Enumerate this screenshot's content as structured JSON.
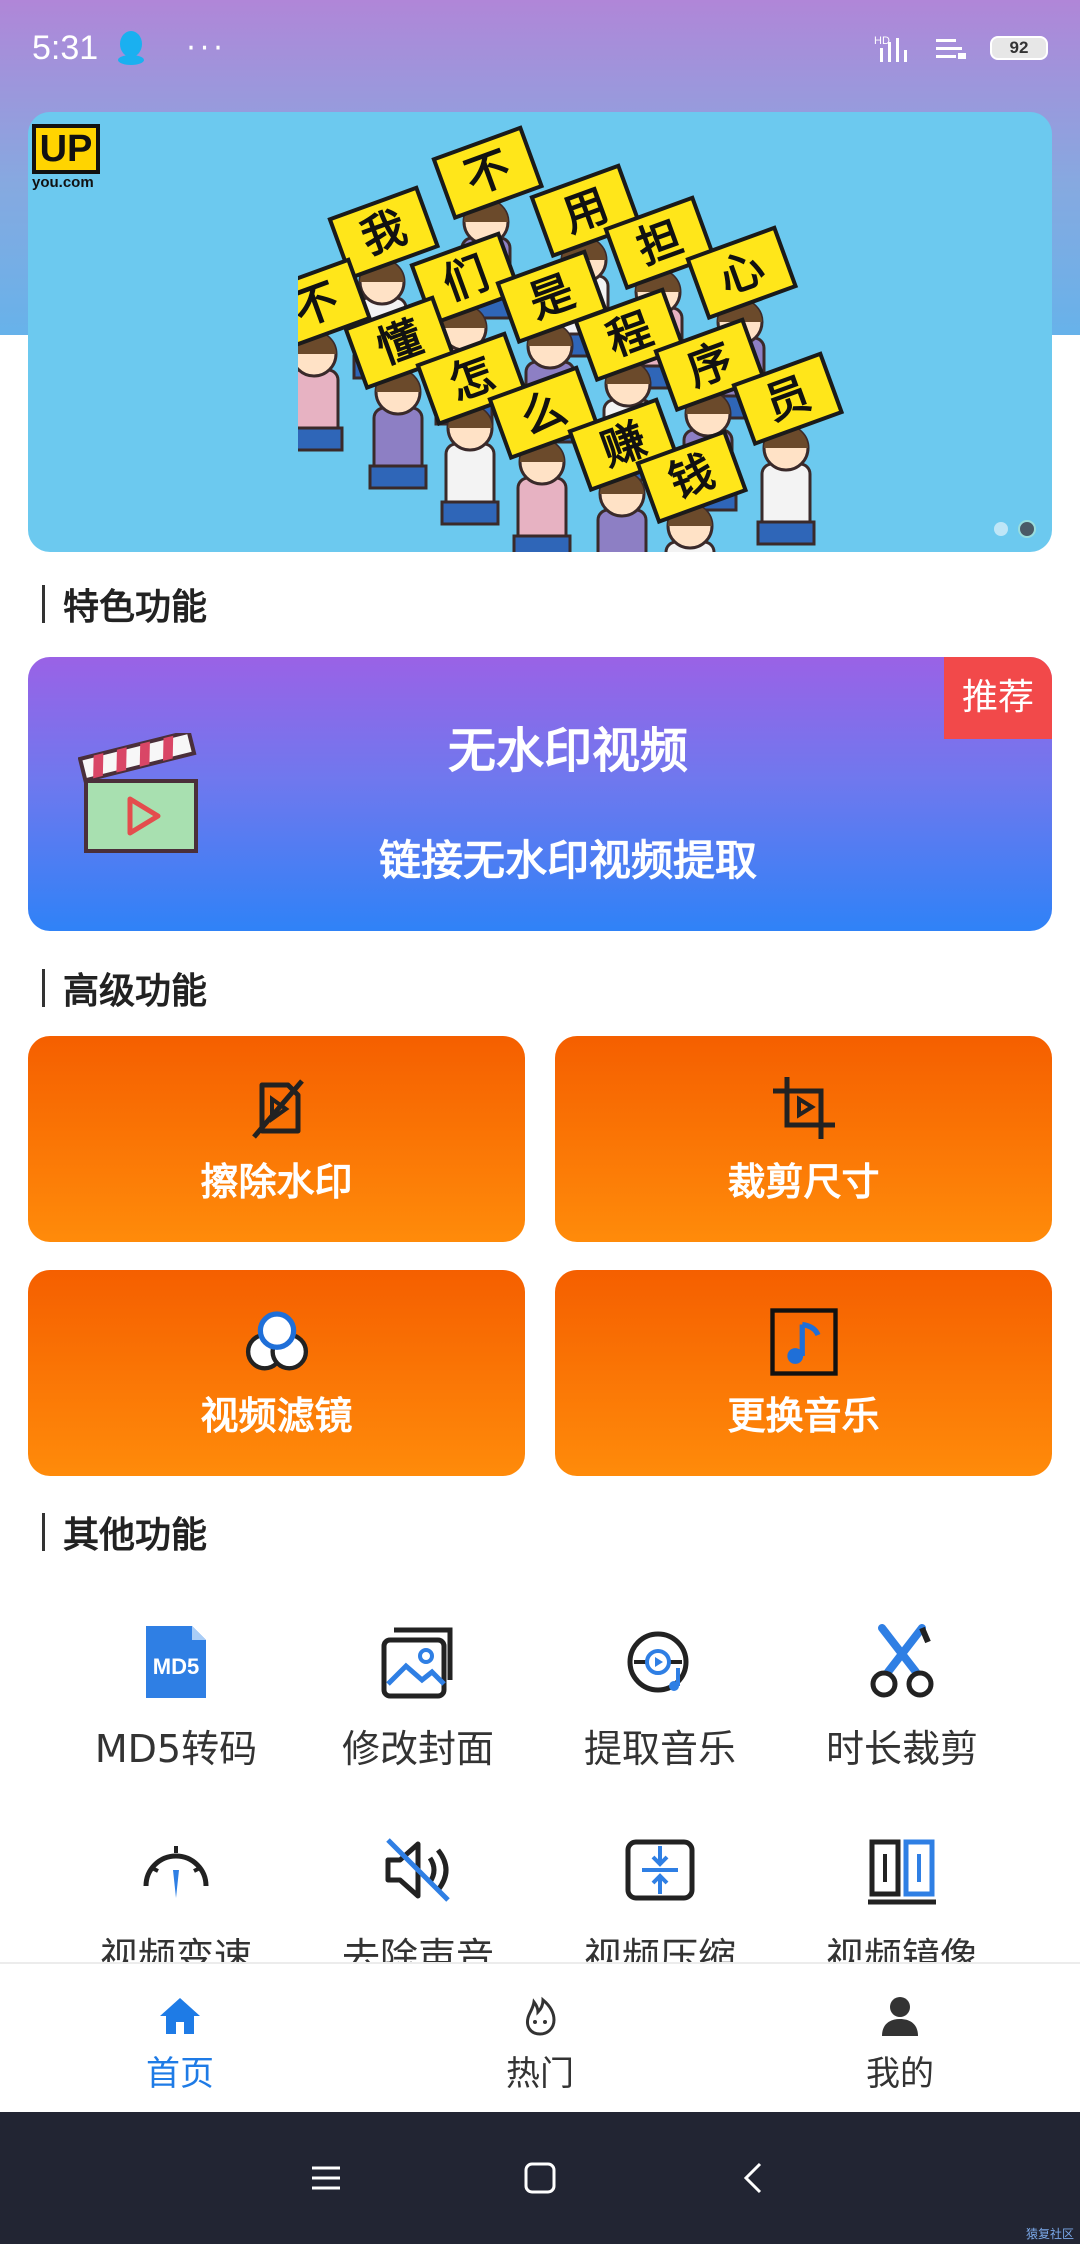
{
  "status": {
    "time": "5:31",
    "dots": "···",
    "battery": "92"
  },
  "banner": {
    "logo_text": "UP",
    "logo_sub": "you.com",
    "chars": [
      "不",
      "用",
      "担",
      "心",
      "我",
      "们",
      "是",
      "程",
      "序",
      "员",
      "不",
      "懂",
      "怎",
      "么",
      "赚",
      "钱"
    ]
  },
  "sections": {
    "featured": "特色功能",
    "advanced": "高级功能",
    "other": "其他功能"
  },
  "featured_card": {
    "badge": "推荐",
    "title": "无水印视频",
    "subtitle": "链接无水印视频提取"
  },
  "advanced": [
    {
      "label": "擦除水印",
      "icon": "no-watermark-icon"
    },
    {
      "label": "裁剪尺寸",
      "icon": "crop-icon"
    },
    {
      "label": "视频滤镜",
      "icon": "filter-icon"
    },
    {
      "label": "更换音乐",
      "icon": "music-icon"
    }
  ],
  "tools": [
    {
      "label": "MD5转码",
      "icon": "md5-file-icon"
    },
    {
      "label": "修改封面",
      "icon": "image-icon"
    },
    {
      "label": "提取音乐",
      "icon": "disc-music-icon"
    },
    {
      "label": "时长裁剪",
      "icon": "scissors-icon"
    },
    {
      "label": "视频变速",
      "icon": "speedometer-icon"
    },
    {
      "label": "去除声音",
      "icon": "mute-icon"
    },
    {
      "label": "视频压缩",
      "icon": "compress-icon"
    },
    {
      "label": "视频镜像",
      "icon": "mirror-icon"
    }
  ],
  "tabs": [
    {
      "label": "首页",
      "icon": "home-icon"
    },
    {
      "label": "热门",
      "icon": "hot-icon"
    },
    {
      "label": "我的",
      "icon": "user-icon"
    }
  ],
  "watermark": "猿复社区",
  "colors": {
    "accent": "#1e7be6",
    "orange": "#f76a04",
    "badge": "#f2494a"
  }
}
